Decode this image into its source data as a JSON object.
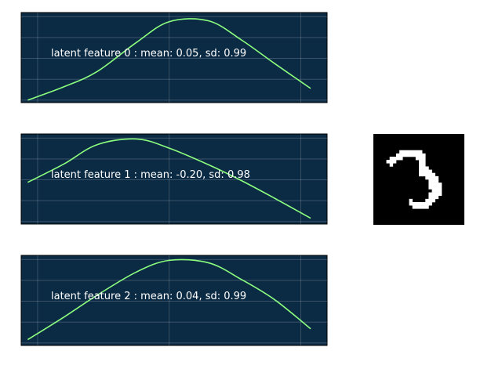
{
  "colors": {
    "panel_background": "#0b2a44",
    "curve": "#8cff7e",
    "label_text": "#ffffff",
    "figure_background": "#ffffff",
    "digit_background": "#000000",
    "digit_foreground": "#ffffff"
  },
  "chart_data": [
    {
      "type": "line",
      "label": "latent feature 0 : mean: 0.05, sd: 0.99",
      "mean": 0.05,
      "sd": 0.99,
      "grid": true,
      "axis_labels_visible": false,
      "x": [
        -2.15,
        -1.6,
        -1.1,
        -0.5,
        0.0,
        0.6,
        1.1,
        1.6,
        2.15
      ],
      "y": [
        0.0,
        0.16,
        0.34,
        0.69,
        0.94,
        0.95,
        0.72,
        0.44,
        0.14
      ],
      "xlim": [
        -2.25,
        2.4
      ],
      "ylim": [
        -0.03,
        1.05
      ]
    },
    {
      "type": "line",
      "label": "latent feature 1 : mean: -0.20, sd: 0.98",
      "mean": -0.2,
      "sd": 0.98,
      "grid": true,
      "axis_labels_visible": false,
      "x": [
        -2.15,
        -1.6,
        -1.1,
        -0.5,
        0.0,
        0.6,
        1.1,
        1.6,
        2.15
      ],
      "y": [
        0.47,
        0.69,
        0.92,
        0.99,
        0.88,
        0.68,
        0.49,
        0.28,
        0.04
      ],
      "xlim": [
        -2.25,
        2.4
      ],
      "ylim": [
        -0.03,
        1.05
      ]
    },
    {
      "type": "line",
      "label": "latent feature 2 : mean: 0.04, sd: 0.99",
      "mean": 0.04,
      "sd": 0.99,
      "grid": true,
      "axis_labels_visible": false,
      "x": [
        -2.15,
        -1.6,
        -1.1,
        -0.5,
        0.0,
        0.6,
        1.1,
        1.6,
        2.15
      ],
      "y": [
        0.04,
        0.31,
        0.57,
        0.85,
        0.99,
        0.96,
        0.76,
        0.52,
        0.17
      ],
      "xlim": [
        -2.25,
        2.4
      ],
      "ylim": [
        -0.03,
        1.05
      ]
    }
  ],
  "digit_image": {
    "resolution": 28,
    "rows": [
      "0000000000000000000000000000",
      "0000000000000000000000000000",
      "0000000000000000000000000000",
      "0000000000000000000000000000",
      "0000000000000000000000000000",
      "0000000011111110000000000000",
      "0000000111111111000000000000",
      "0000011110000111000000000000",
      "0000111000000011000000000000",
      "0000010000000011000000000000",
      "0000000000000011100000000000",
      "0000000000000011110000000000",
      "0000000000000011111000000000",
      "0000000000000000111100000000",
      "0000000000000000011100000000",
      "0000000000000000011110000000",
      "0000000000000000011110000000",
      "0000000000000000001110000000",
      "0000000000000000011110000000",
      "0000000000000000011100000000",
      "0000000000010000111000000000",
      "0000000000011111110000000000",
      "0000000000001111100000000000",
      "0000000000000000000000000000",
      "0000000000000000000000000000",
      "0000000000000000000000000000",
      "0000000000000000000000000000",
      "0000000000000000000000000000"
    ]
  }
}
